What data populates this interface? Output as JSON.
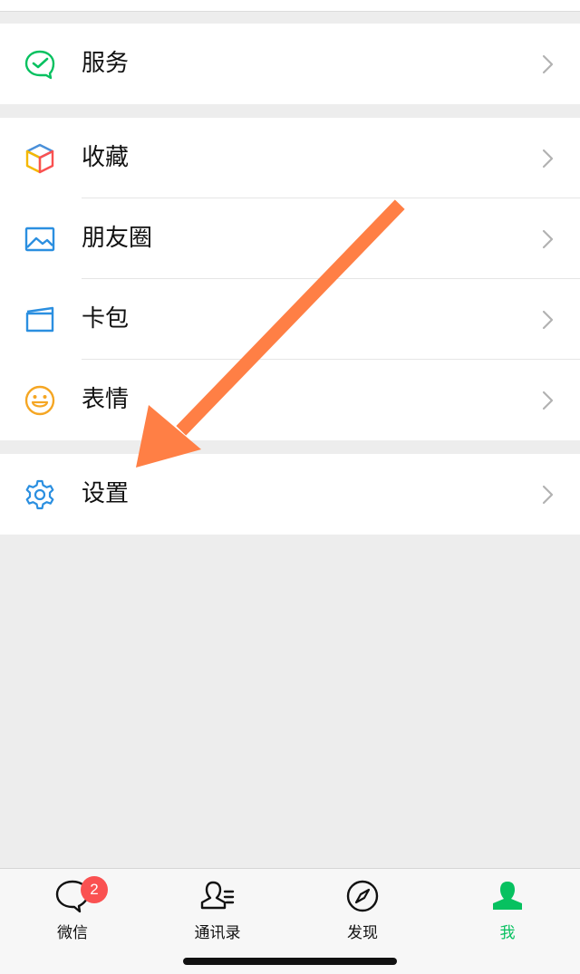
{
  "menu": {
    "service": {
      "label": "服务",
      "icon": "service-check-icon"
    },
    "favorites": {
      "label": "收藏",
      "icon": "favorites-cube-icon"
    },
    "moments": {
      "label": "朋友圈",
      "icon": "moments-picture-icon"
    },
    "cards": {
      "label": "卡包",
      "icon": "cards-wallet-icon"
    },
    "stickers": {
      "label": "表情",
      "icon": "stickers-smile-icon"
    },
    "settings": {
      "label": "设置",
      "icon": "settings-gear-icon"
    }
  },
  "tabbar": {
    "chats": {
      "label": "微信",
      "badge": "2",
      "icon": "chats-bubble-icon"
    },
    "contacts": {
      "label": "通讯录",
      "icon": "contacts-person-icon"
    },
    "discover": {
      "label": "发现",
      "icon": "discover-compass-icon"
    },
    "me": {
      "label": "我",
      "icon": "me-person-icon",
      "active": true
    }
  },
  "colors": {
    "accent_green": "#07c160",
    "badge_red": "#fa5151",
    "annotation_arrow": "#ff7f45",
    "background": "#ededed"
  }
}
